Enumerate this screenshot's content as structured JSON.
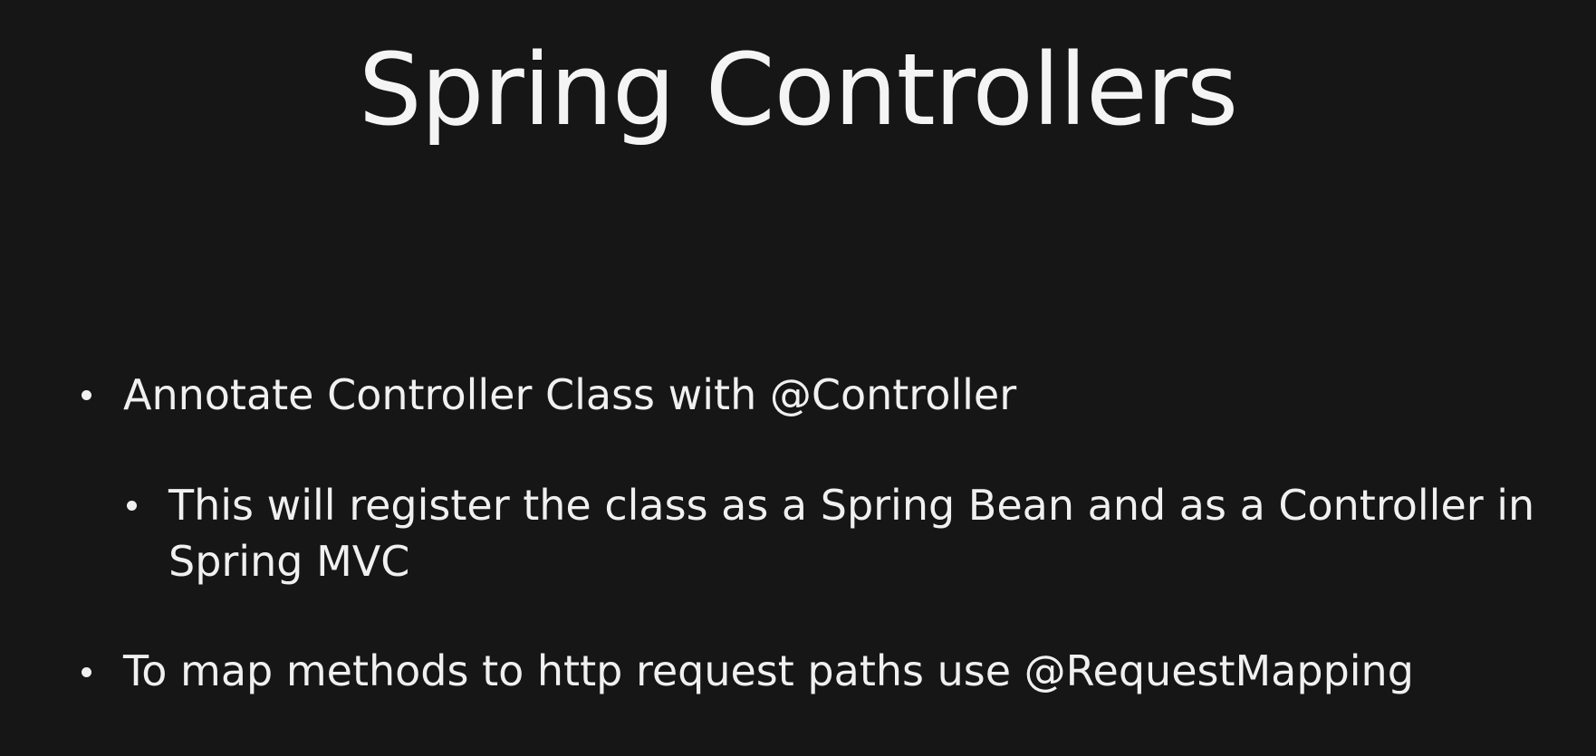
{
  "slide": {
    "title": "Spring Controllers",
    "bullets": [
      {
        "level": 1,
        "text": "Annotate Controller Class with @Controller"
      },
      {
        "level": 2,
        "text": "This will register the class as a Spring Bean and as a Controller in Spring MVC"
      },
      {
        "level": 1,
        "text": "To map methods to http request paths use @RequestMapping"
      }
    ],
    "colors": {
      "background": "#161616",
      "text": "#f2f2f2"
    }
  }
}
